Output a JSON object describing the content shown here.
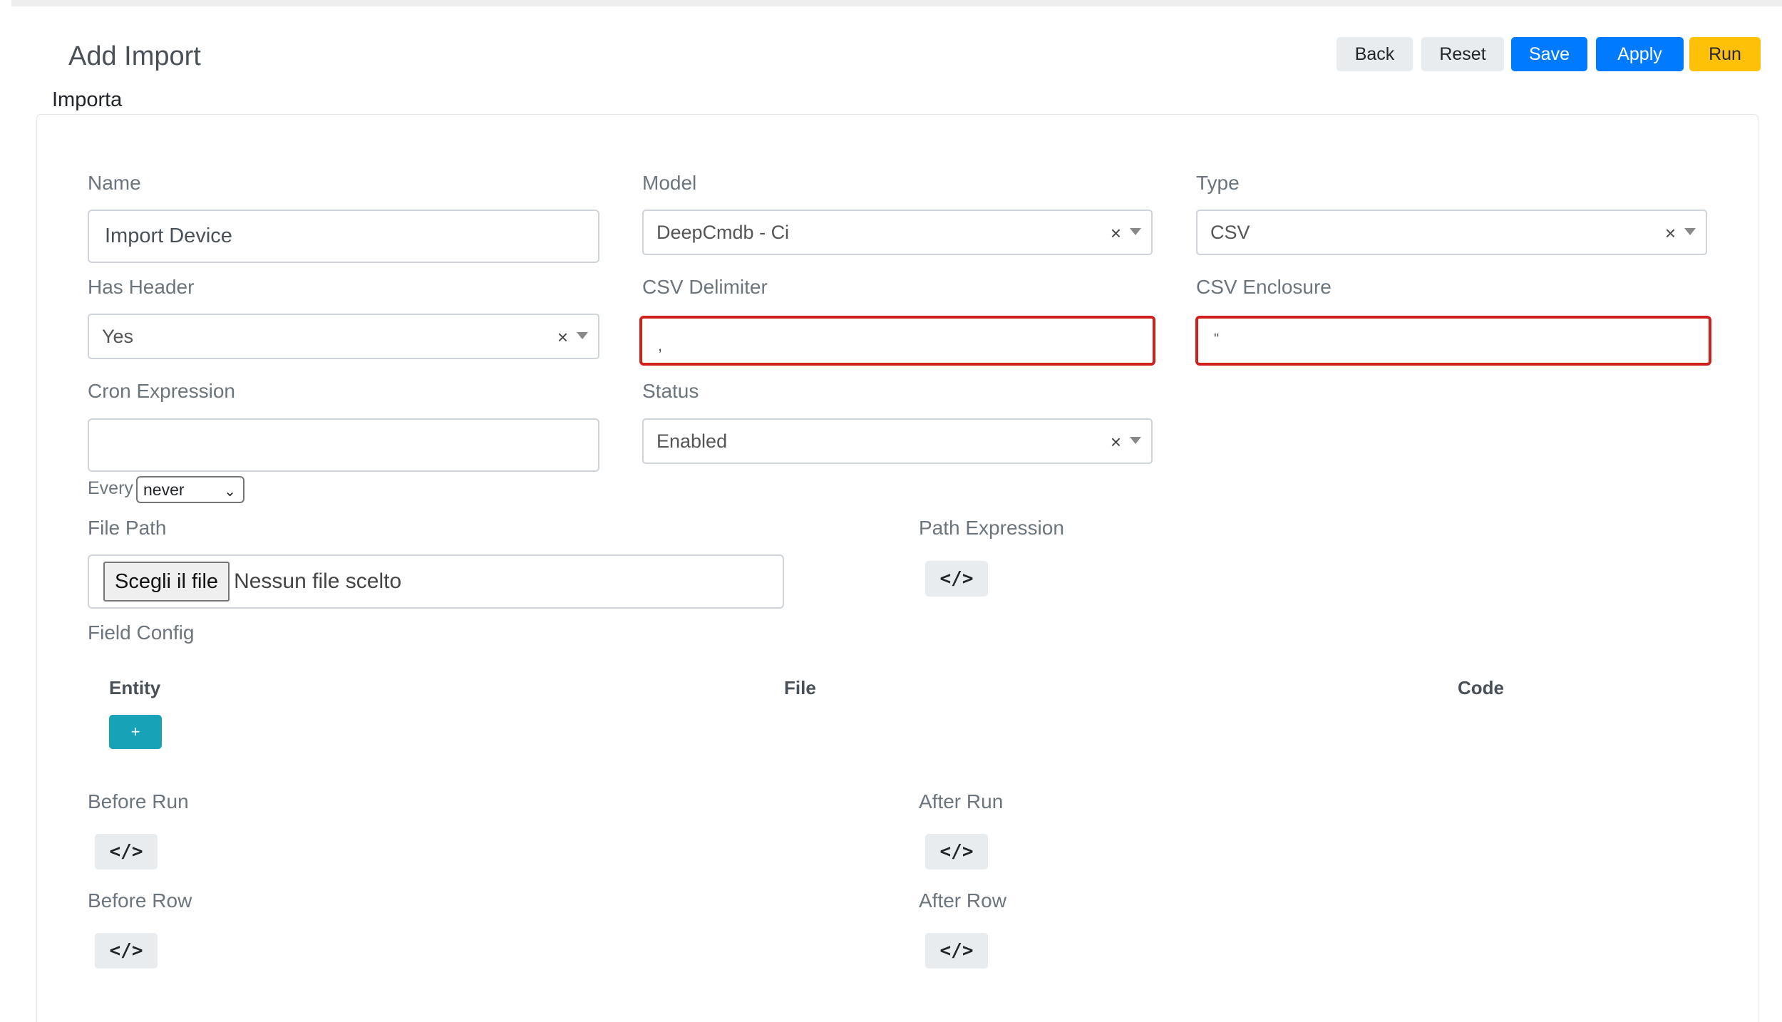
{
  "header": {
    "title": "Add Import",
    "section": "Importa",
    "buttons": {
      "back": "Back",
      "reset": "Reset",
      "save": "Save",
      "apply": "Apply",
      "run": "Run"
    }
  },
  "form": {
    "name": {
      "label": "Name",
      "value": "Import Device"
    },
    "model": {
      "label": "Model",
      "value": "DeepCmdb - Ci"
    },
    "type": {
      "label": "Type",
      "value": "CSV"
    },
    "has_header": {
      "label": "Has Header",
      "value": "Yes"
    },
    "csv_delimiter": {
      "label": "CSV Delimiter",
      "value": ","
    },
    "csv_enclosure": {
      "label": "CSV Enclosure",
      "value": "\""
    },
    "cron_expression": {
      "label": "Cron Expression",
      "value": "",
      "every_label": "Every",
      "every_value": "never"
    },
    "status": {
      "label": "Status",
      "value": "Enabled"
    },
    "file_path": {
      "label": "File Path",
      "button": "Scegli il file",
      "text": "Nessun file scelto"
    },
    "path_expression": {
      "label": "Path Expression"
    },
    "field_config": {
      "label": "Field Config",
      "columns": [
        "Entity",
        "File",
        "Code"
      ],
      "add_label": "+"
    },
    "before_run": {
      "label": "Before Run"
    },
    "after_run": {
      "label": "After Run"
    },
    "before_row": {
      "label": "Before Row"
    },
    "after_row": {
      "label": "After Row"
    }
  },
  "icons": {
    "clear": "×",
    "code": "</>"
  },
  "colors": {
    "primary": "#007bff",
    "warning": "#ffc107",
    "info": "#17a2b8",
    "error": "#d0201c"
  }
}
